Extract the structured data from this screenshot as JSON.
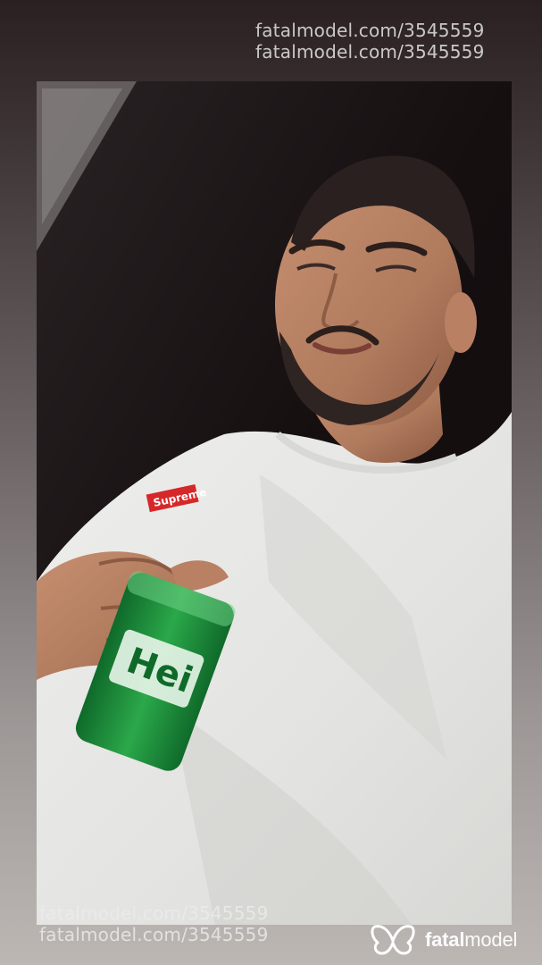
{
  "watermark": {
    "top_line_1": "fatalmodel.com/3545559",
    "top_line_2": "fatalmodel.com/3545559",
    "bottom_line_1": "fatalmodel.com/3545559",
    "bottom_line_2": "fatalmodel.com/3545559"
  },
  "brand": {
    "name_bold": "fatal",
    "name_regular": "model",
    "logo_icon": "butterfly-icon"
  },
  "photo": {
    "content": "selfie-photo",
    "can_text": "Hei",
    "shirt_label": "Supreme"
  },
  "colors": {
    "background_top": "#2a2021",
    "background_bottom": "#bdb7b4",
    "watermark": "#ebebeb",
    "can_green": "#1f8a3a"
  }
}
